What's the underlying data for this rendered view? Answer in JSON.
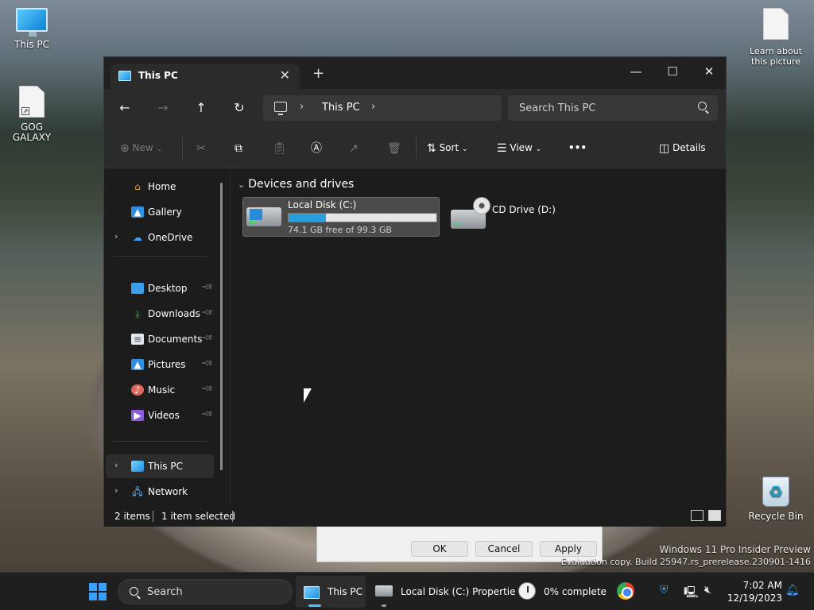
{
  "desktop": {
    "icons": [
      {
        "label": "This PC"
      },
      {
        "label": "GOG GALAXY"
      },
      {
        "label": "Learn about this picture"
      },
      {
        "label": "Recycle Bin"
      }
    ],
    "watermark_line1": "Windows 11 Pro Insider Preview",
    "watermark_line2": "Evaluation copy. Build 25947.rs_prerelease.230901-1416"
  },
  "dialog_behind": {
    "ok": "OK",
    "cancel": "Cancel",
    "apply": "Apply"
  },
  "window": {
    "tab_title": "This PC",
    "tab_close": "✕",
    "new_tab": "+",
    "controls": {
      "minimize": "—",
      "maximize": "☐",
      "close": "✕"
    },
    "nav": {
      "back": "←",
      "forward": "→",
      "up": "↑",
      "refresh": "↻"
    },
    "address": {
      "chevron": "›",
      "crumb": "This PC"
    },
    "search": {
      "placeholder": "Search This PC"
    },
    "commands": {
      "new": "New",
      "sort": "Sort",
      "view": "View",
      "more": "•••",
      "details": "Details"
    },
    "nav_pane": {
      "home": "Home",
      "gallery": "Gallery",
      "onedrive": "OneDrive",
      "desktop": "Desktop",
      "downloads": "Downloads",
      "documents": "Documents",
      "pictures": "Pictures",
      "music": "Music",
      "videos": "Videos",
      "this_pc": "This PC",
      "network": "Network"
    },
    "group": "Devices and drives",
    "drives": [
      {
        "name": "Local Disk (C:)",
        "free_text": "74.1 GB free of 99.3 GB",
        "used_fraction": 0.254
      },
      {
        "name": "CD Drive (D:)"
      }
    ],
    "status": {
      "items": "2 items",
      "selected": "1 item selected"
    }
  },
  "taskbar": {
    "search_label": "Search",
    "apps": [
      {
        "label": "This PC"
      },
      {
        "label": "Local Disk (C:) Propertie"
      },
      {
        "label": "0% complete"
      }
    ],
    "time": "7:02 AM",
    "date": "12/19/2023"
  },
  "colors": {
    "accent": "#2a9fe0",
    "window_bg": "#1c1c1c",
    "toolbar_bg": "#2b2b2b"
  }
}
